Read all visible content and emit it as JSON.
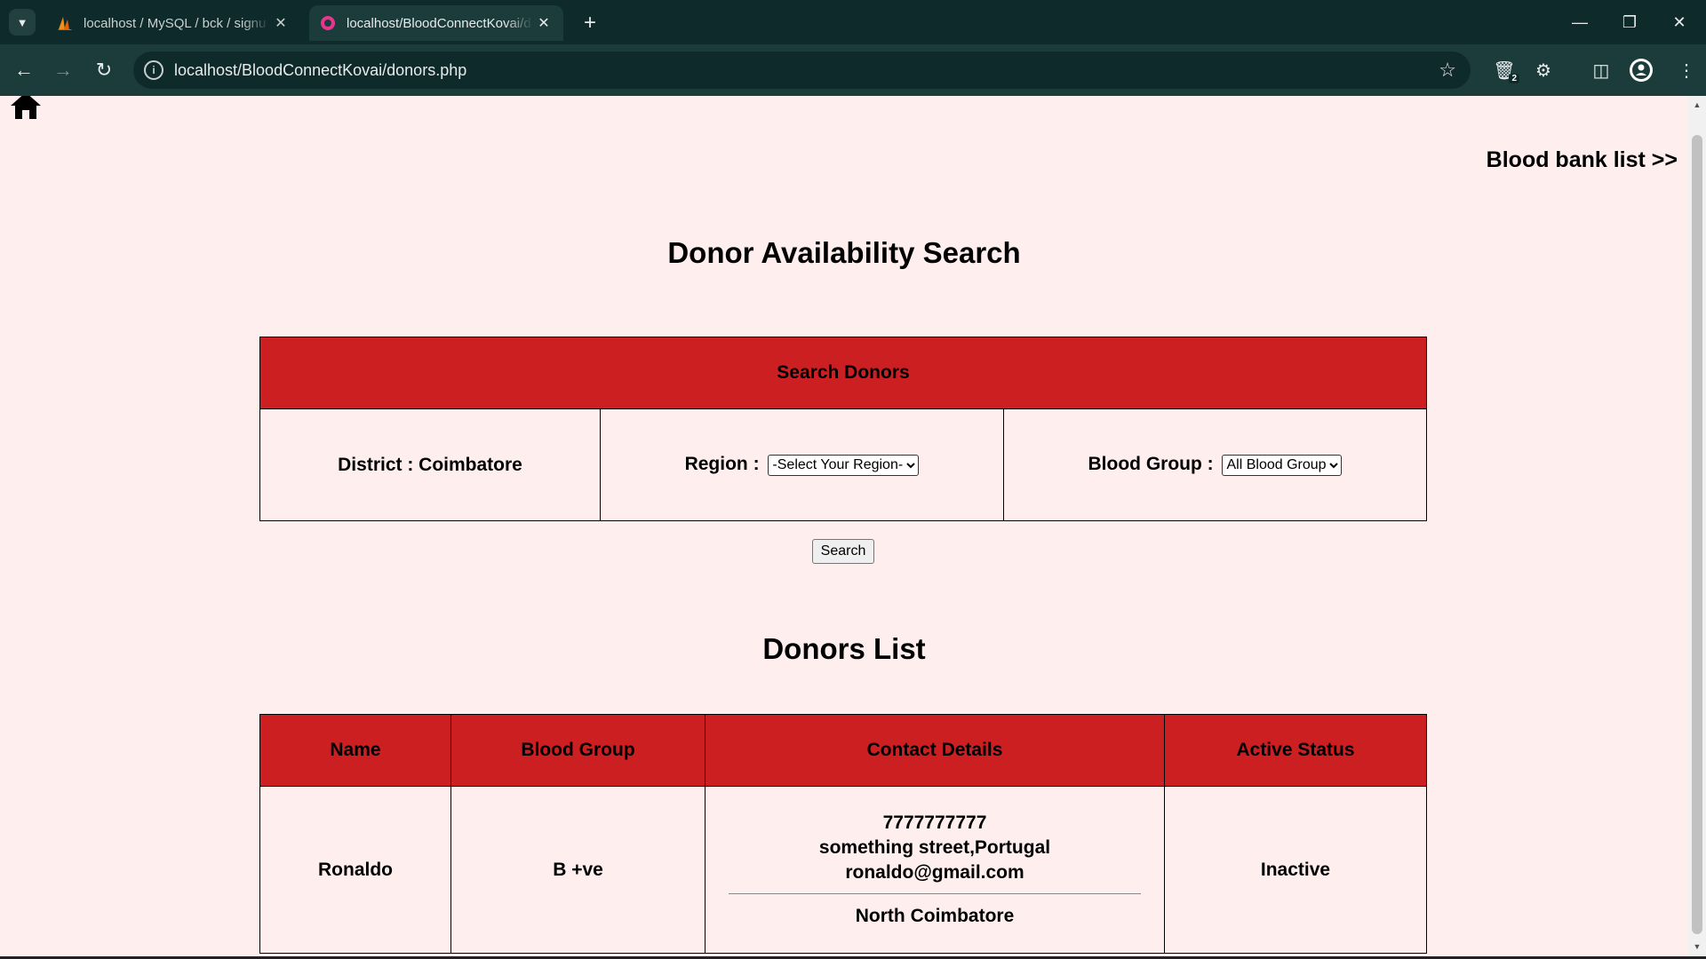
{
  "browser": {
    "tabs": [
      {
        "title": "localhost / MySQL / bck / signu",
        "active": false
      },
      {
        "title": "localhost/BloodConnectKovai/d",
        "active": true
      }
    ],
    "url": "localhost/BloodConnectKovai/donors.php",
    "extensions_badge": "2"
  },
  "page": {
    "blood_bank_link": "Blood bank list >>",
    "title": "Donor Availability Search",
    "search": {
      "header": "Search Donors",
      "district_label": "District : Coimbatore",
      "region_label": "Region :",
      "region_selected": "-Select Your Region-",
      "blood_group_label": "Blood Group :",
      "blood_group_selected": "All Blood Group",
      "button": "Search"
    },
    "donors": {
      "title": "Donors List",
      "columns": [
        "Name",
        "Blood Group",
        "Contact Details",
        "Active Status"
      ],
      "rows": [
        {
          "name": "Ronaldo",
          "blood_group": "B +ve",
          "phone": "7777777777",
          "address": "something street,Portugal",
          "email": "ronaldo@gmail.com",
          "region": "North Coimbatore",
          "status": "Inactive"
        }
      ]
    }
  },
  "colors": {
    "page_bg": "#ffeeee",
    "header_red": "#cc1f22",
    "chrome_dark": "#0f2a2b",
    "chrome_toolbar": "#1c3b3b"
  }
}
